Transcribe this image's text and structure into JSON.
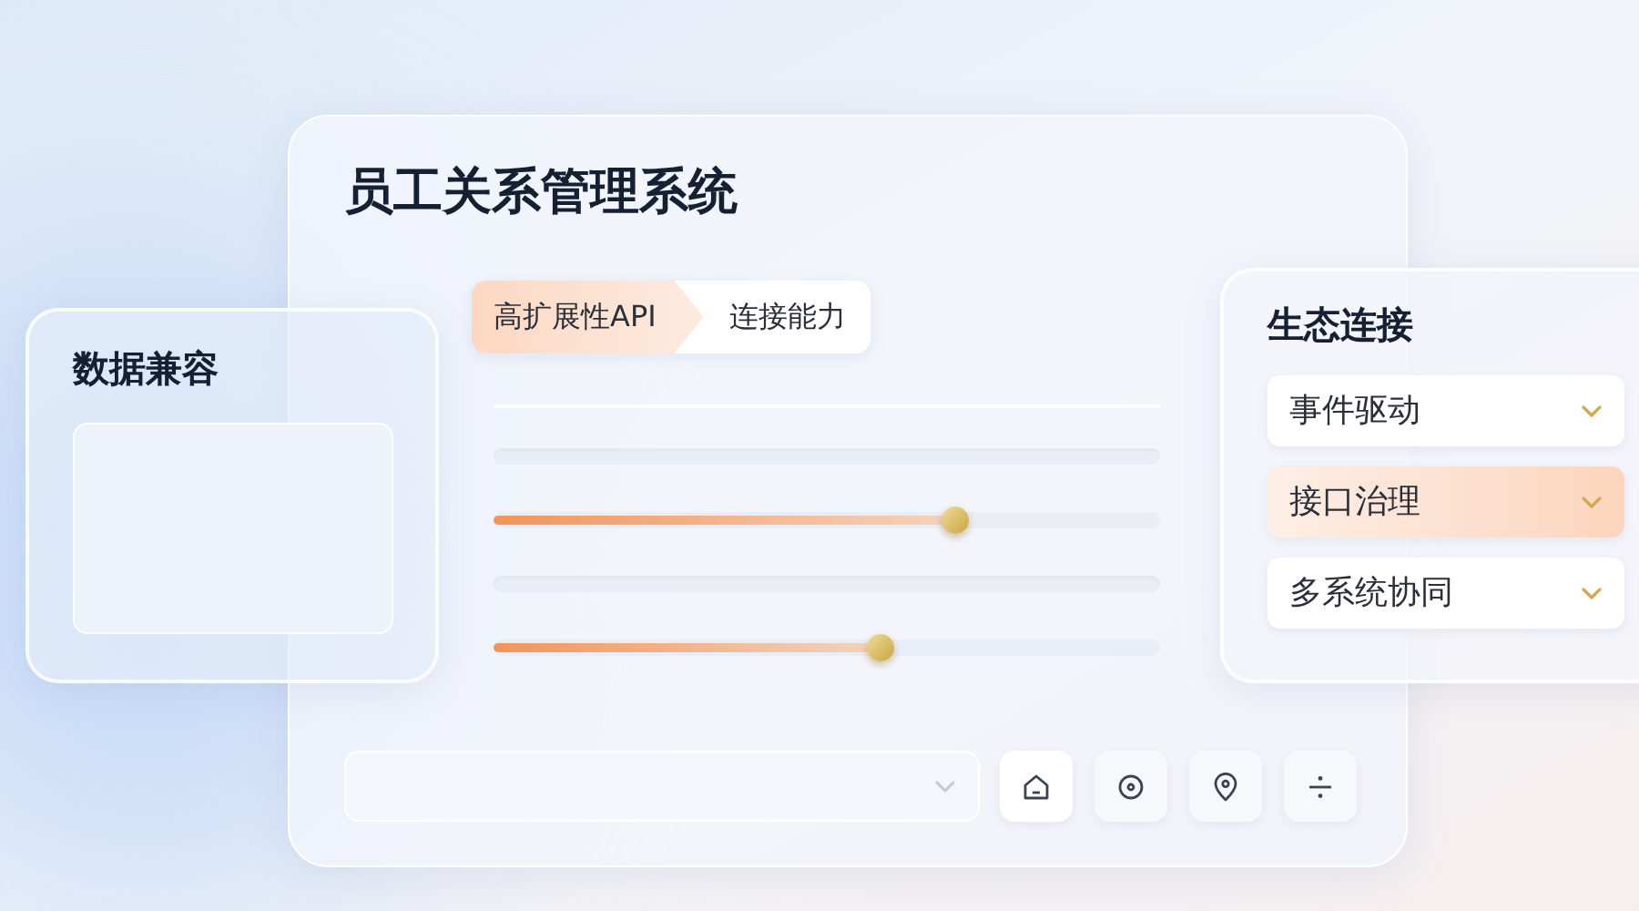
{
  "main_panel": {
    "title": "员工关系管理系统",
    "tabs": [
      {
        "label": "高扩展性API",
        "selected": true
      },
      {
        "label": "连接能力",
        "selected": false
      }
    ],
    "sliders": [
      {
        "level": 0.69
      },
      {
        "level": 0.58
      }
    ]
  },
  "left_card": {
    "title": "数据兼容"
  },
  "right_card": {
    "title": "生态连接",
    "items": [
      {
        "label": "事件驱动",
        "selected": false
      },
      {
        "label": "接口治理",
        "selected": true
      },
      {
        "label": "多系统协同",
        "selected": false
      }
    ]
  }
}
